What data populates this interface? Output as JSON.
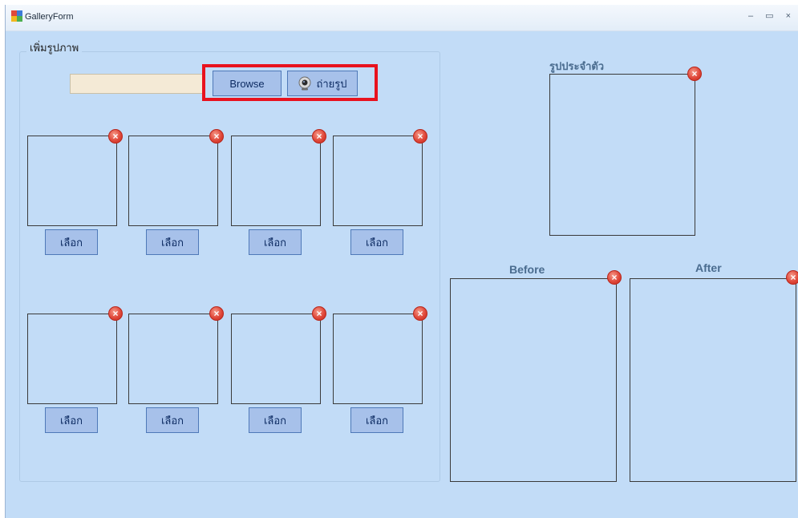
{
  "window": {
    "title": "GalleryForm",
    "controls": "– ▭ ×"
  },
  "add_group": {
    "title": "เพิ่มรูปภาพ",
    "path_value": "",
    "browse_label": "Browse",
    "capture_label": "ถ่ายรูป"
  },
  "gallery": {
    "select_label": "เลือก",
    "remove_glyph": "×"
  },
  "profile": {
    "label": "รูปประจำตัว"
  },
  "compare": {
    "before_label": "Before",
    "after_label": "After"
  },
  "colors": {
    "background": "#c2dcf7",
    "button": "#a7c1ea",
    "highlight": "#e8121e",
    "remove": "#e0483a"
  }
}
